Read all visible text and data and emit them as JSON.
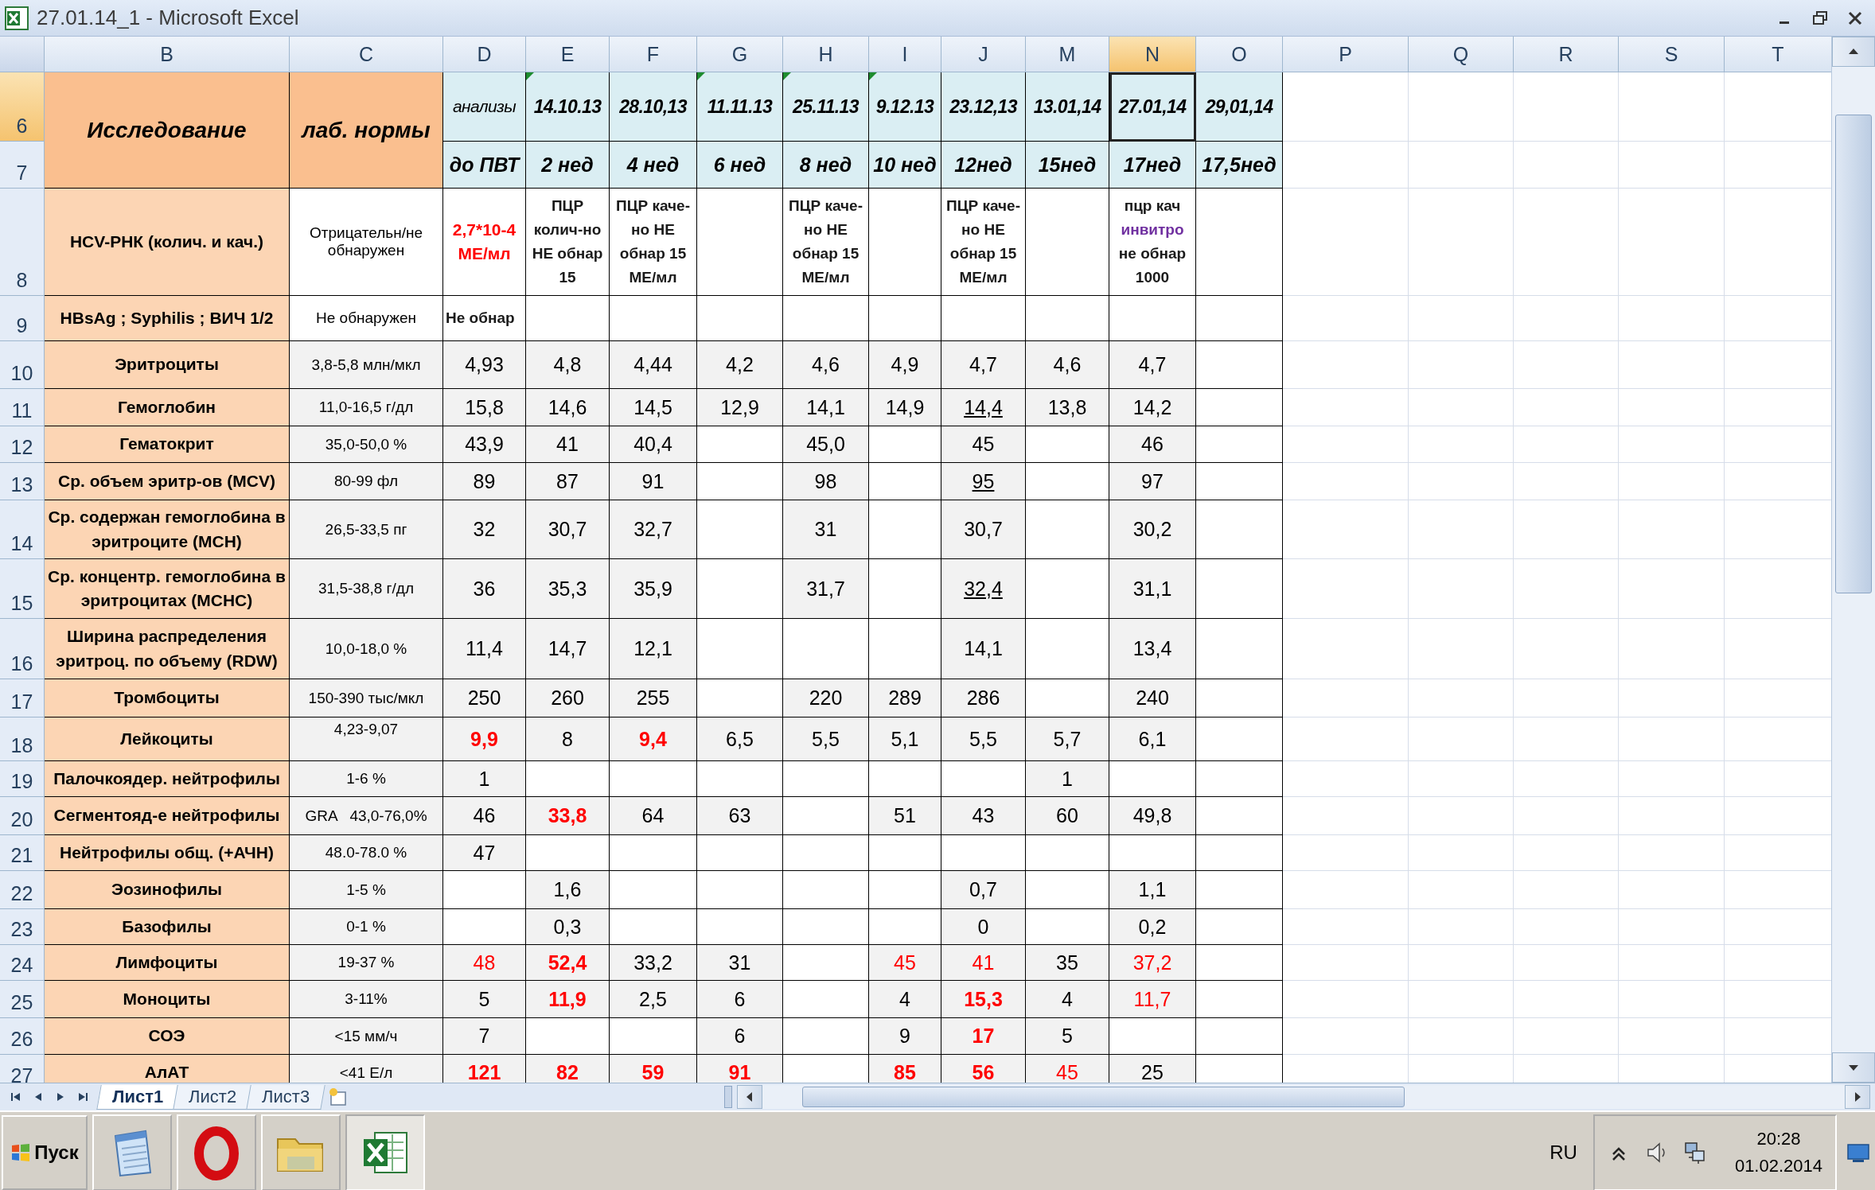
{
  "window": {
    "title": "27.01.14_1 - Microsoft Excel"
  },
  "columns": [
    {
      "label": "B",
      "selected": false
    },
    {
      "label": "C",
      "selected": false
    },
    {
      "label": "D",
      "selected": false
    },
    {
      "label": "E",
      "selected": false
    },
    {
      "label": "F",
      "selected": false
    },
    {
      "label": "G",
      "selected": false
    },
    {
      "label": "H",
      "selected": false
    },
    {
      "label": "I",
      "selected": false
    },
    {
      "label": "J",
      "selected": false
    },
    {
      "label": "M",
      "selected": false
    },
    {
      "label": "N",
      "selected": true
    },
    {
      "label": "O",
      "selected": false
    },
    {
      "label": "P",
      "selected": false
    },
    {
      "label": "Q",
      "selected": false
    },
    {
      "label": "R",
      "selected": false
    },
    {
      "label": "S",
      "selected": false
    },
    {
      "label": "T",
      "selected": false
    }
  ],
  "header": {
    "study": "Исследование",
    "norms": "лаб. нормы",
    "row_numbers": [
      {
        "label": "6",
        "selected": true
      },
      {
        "label": "7",
        "selected": false
      }
    ],
    "dates": [
      {
        "text": "анализы",
        "kind": "caption",
        "flagged": false,
        "selected": false
      },
      {
        "text": "14.10.13",
        "kind": "date",
        "flagged": true,
        "selected": false
      },
      {
        "text": "28.10,13",
        "kind": "date",
        "flagged": false,
        "selected": false
      },
      {
        "text": "11.11.13",
        "kind": "date",
        "flagged": true,
        "selected": false
      },
      {
        "text": "25.11.13",
        "kind": "date",
        "flagged": true,
        "selected": false
      },
      {
        "text": "9.12.13",
        "kind": "date",
        "flagged": true,
        "selected": false
      },
      {
        "text": "23.12,13",
        "kind": "date",
        "flagged": false,
        "selected": false
      },
      {
        "text": "13.01,14",
        "kind": "date",
        "flagged": false,
        "selected": false
      },
      {
        "text": "27.01,14",
        "kind": "date",
        "flagged": false,
        "selected": true
      },
      {
        "text": "29,01,14",
        "kind": "date",
        "flagged": false,
        "selected": false
      }
    ],
    "weeks": [
      "до ПВТ",
      "2 нед",
      "4 нед",
      "6 нед",
      "8 нед",
      "10 нед",
      "12нед",
      "15нед",
      "17нед",
      "17,5нед"
    ]
  },
  "rows": [
    {
      "number": "8",
      "selected": false,
      "kind": "text",
      "test": "HCV-РНК (колич. и кач.)",
      "norm": "Отрицательн/не обнаружен",
      "values": [
        {
          "text": "2,7*10-4 МЕ/мл",
          "kind": "alert"
        },
        "ПЦР колич-но НЕ обнар 15",
        "ПЦР каче-но НЕ обнар 15 МЕ/мл",
        {
          "kind": "empty"
        },
        "ПЦР каче-но НЕ обнар 15 МЕ/мл",
        {
          "kind": "empty"
        },
        "ПЦР каче-но НЕ обнар 15 МЕ/мл",
        {
          "kind": "empty"
        },
        {
          "kind": "mixed",
          "parts": [
            {
              "text": "пцр кач",
              "kind": "plain"
            },
            {
              "text": "инвитро",
              "kind": "highlight"
            },
            {
              "text": "не обнар 1000",
              "kind": "plain"
            }
          ]
        },
        {
          "kind": "empty"
        }
      ]
    },
    {
      "number": "9",
      "selected": false,
      "kind": "text",
      "test": "HBsAg ; Syphilis ; ВИЧ 1/2",
      "norm": "Не обнаружен",
      "values": [
        {
          "text": "Не обнар",
          "kind": "bold"
        },
        {
          "kind": "empty"
        },
        {
          "kind": "empty"
        },
        {
          "kind": "empty"
        },
        {
          "kind": "empty"
        },
        {
          "kind": "empty"
        },
        {
          "kind": "empty"
        },
        {
          "kind": "empty"
        },
        {
          "kind": "empty"
        },
        {
          "kind": "empty"
        }
      ]
    },
    {
      "number": "10",
      "selected": false,
      "kind": "numeric",
      "test": "Эритроциты",
      "norm": "3,8-5,8 млн/мкл",
      "values": [
        "4,93",
        "4,8",
        "4,44",
        "4,2",
        "4,6",
        "4,9",
        "4,7",
        "4,6",
        "4,7",
        {
          "kind": "empty"
        }
      ]
    },
    {
      "number": "11",
      "selected": false,
      "kind": "numeric",
      "test": "Гемоглобин",
      "norm": "11,0-16,5 г/дл",
      "values": [
        "15,8",
        "14,6",
        "14,5",
        "12,9",
        "14,1",
        "14,9",
        {
          "text": "14,4",
          "kind": "underline"
        },
        "13,8",
        "14,2",
        {
          "kind": "empty"
        }
      ]
    },
    {
      "number": "12",
      "selected": false,
      "kind": "numeric",
      "test": "Гематокрит",
      "norm": "35,0-50,0 %",
      "values": [
        "43,9",
        "41",
        "40,4",
        {
          "kind": "empty"
        },
        "45,0",
        {
          "kind": "empty"
        },
        "45",
        {
          "kind": "empty"
        },
        "46",
        {
          "kind": "empty"
        }
      ]
    },
    {
      "number": "13",
      "selected": false,
      "kind": "numeric",
      "test": "Ср. объем эритр-ов (MCV)",
      "norm": "80-99 фл",
      "values": [
        "89",
        "87",
        "91",
        {
          "kind": "empty"
        },
        "98",
        {
          "kind": "empty"
        },
        {
          "text": "95",
          "kind": "underline"
        },
        {
          "kind": "empty"
        },
        "97",
        {
          "kind": "empty"
        }
      ]
    },
    {
      "number": "14",
      "selected": false,
      "kind": "numeric",
      "test": "Ср. содержан гемоглобина в эритроците (MCH)",
      "norm": "26,5-33,5 пг",
      "values": [
        "32",
        "30,7",
        "32,7",
        {
          "kind": "empty"
        },
        "31",
        {
          "kind": "empty"
        },
        "30,7",
        {
          "kind": "empty"
        },
        "30,2",
        {
          "kind": "empty"
        }
      ]
    },
    {
      "number": "15",
      "selected": false,
      "kind": "numeric",
      "test": "Ср. концентр. гемоглобина в эритроцитах (MCHC)",
      "norm": "31,5-38,8 г/дл",
      "values": [
        "36",
        "35,3",
        "35,9",
        {
          "kind": "empty"
        },
        "31,7",
        {
          "kind": "empty"
        },
        {
          "text": "32,4",
          "kind": "underline"
        },
        {
          "kind": "empty"
        },
        "31,1",
        {
          "kind": "empty"
        }
      ]
    },
    {
      "number": "16",
      "selected": false,
      "kind": "numeric",
      "test": "Ширина распределения эритроц. по объему (RDW)",
      "norm": "10,0-18,0 %",
      "values": [
        "11,4",
        "14,7",
        "12,1",
        {
          "kind": "empty"
        },
        {
          "kind": "empty"
        },
        {
          "kind": "empty"
        },
        "14,1",
        {
          "kind": "empty"
        },
        "13,4",
        {
          "kind": "empty"
        }
      ]
    },
    {
      "number": "17",
      "selected": false,
      "kind": "numeric",
      "test": "Тромбоциты",
      "norm": "150-390 тыс/мкл",
      "values": [
        "250",
        "260",
        "255",
        {
          "kind": "empty"
        },
        "220",
        "289",
        "286",
        {
          "kind": "empty"
        },
        "240",
        {
          "kind": "empty"
        }
      ]
    },
    {
      "number": "18",
      "selected": false,
      "kind": "numeric",
      "test": "Лейкоциты",
      "norm": "4,23-9,07",
      "values": [
        {
          "text": "9,9",
          "kind": "alert"
        },
        "8",
        {
          "text": "9,4",
          "kind": "alert"
        },
        "6,5",
        "5,5",
        "5,1",
        "5,5",
        "5,7",
        "6,1",
        {
          "kind": "empty"
        }
      ]
    },
    {
      "number": "19",
      "selected": false,
      "kind": "numeric",
      "test": "Палочкоядер. нейтрофилы",
      "norm": "1-6 %",
      "values": [
        "1",
        {
          "kind": "empty"
        },
        {
          "kind": "empty"
        },
        {
          "kind": "empty"
        },
        {
          "kind": "empty"
        },
        {
          "kind": "empty"
        },
        {
          "kind": "empty"
        },
        "1",
        {
          "kind": "empty"
        },
        {
          "kind": "empty"
        }
      ]
    },
    {
      "number": "20",
      "selected": false,
      "kind": "numeric",
      "test": "Сегментояд-е нейтрофилы",
      "norm": "GRA   43,0-76,0%",
      "values": [
        "46",
        {
          "text": "33,8",
          "kind": "alert"
        },
        "64",
        "63",
        {
          "kind": "empty"
        },
        "51",
        "43",
        "60",
        "49,8",
        {
          "kind": "empty"
        }
      ]
    },
    {
      "number": "21",
      "selected": false,
      "kind": "numeric",
      "test": "Нейтрофилы общ. (+АЧН)",
      "norm": "48.0-78.0 %",
      "values": [
        "47",
        {
          "kind": "empty"
        },
        {
          "kind": "empty"
        },
        {
          "kind": "empty"
        },
        {
          "kind": "empty"
        },
        {
          "kind": "empty"
        },
        {
          "kind": "empty"
        },
        {
          "kind": "empty"
        },
        {
          "kind": "empty"
        },
        {
          "kind": "empty"
        }
      ]
    },
    {
      "number": "22",
      "selected": false,
      "kind": "numeric",
      "test": "Эозинофилы",
      "norm": "1-5 %",
      "values": [
        {
          "kind": "empty"
        },
        "1,6",
        {
          "kind": "empty"
        },
        {
          "kind": "empty"
        },
        {
          "kind": "empty"
        },
        {
          "kind": "empty"
        },
        "0,7",
        {
          "kind": "empty"
        },
        "1,1",
        {
          "kind": "empty"
        }
      ]
    },
    {
      "number": "23",
      "selected": false,
      "kind": "numeric",
      "test": "Базофилы",
      "norm": "0-1 %",
      "values": [
        {
          "kind": "empty"
        },
        "0,3",
        {
          "kind": "empty"
        },
        {
          "kind": "empty"
        },
        {
          "kind": "empty"
        },
        {
          "kind": "empty"
        },
        "0",
        {
          "kind": "empty"
        },
        "0,2",
        {
          "kind": "empty"
        }
      ]
    },
    {
      "number": "24",
      "selected": false,
      "kind": "numeric",
      "test": "Лимфоциты",
      "norm": "19-37 %",
      "values": [
        {
          "text": "48",
          "kind": "warn"
        },
        {
          "text": "52,4",
          "kind": "alert"
        },
        "33,2",
        "31",
        {
          "kind": "empty"
        },
        {
          "text": "45",
          "kind": "warn"
        },
        {
          "text": "41",
          "kind": "warn"
        },
        "35",
        {
          "text": "37,2",
          "kind": "warn"
        },
        {
          "kind": "empty"
        }
      ]
    },
    {
      "number": "25",
      "selected": false,
      "kind": "numeric",
      "test": "Моноциты",
      "norm": "3-11%",
      "values": [
        "5",
        {
          "text": "11,9",
          "kind": "alert"
        },
        "2,5",
        "6",
        {
          "kind": "empty"
        },
        "4",
        {
          "text": "15,3",
          "kind": "alert"
        },
        "4",
        {
          "text": "11,7",
          "kind": "warn"
        },
        {
          "kind": "empty"
        }
      ]
    },
    {
      "number": "26",
      "selected": false,
      "kind": "numeric",
      "test": "СОЭ",
      "norm": "<15 мм/ч",
      "values": [
        "7",
        {
          "kind": "empty"
        },
        {
          "kind": "empty"
        },
        "6",
        {
          "kind": "empty"
        },
        "9",
        {
          "text": "17",
          "kind": "alert"
        },
        "5",
        {
          "kind": "empty"
        },
        {
          "kind": "empty"
        }
      ]
    },
    {
      "number": "27",
      "selected": false,
      "kind": "numeric",
      "test": "АлАТ",
      "norm": "<41 Е/л",
      "values": [
        {
          "text": "121",
          "kind": "alert"
        },
        {
          "text": "82",
          "kind": "alert"
        },
        {
          "text": "59",
          "kind": "alert"
        },
        {
          "text": "91",
          "kind": "alert"
        },
        {
          "kind": "empty"
        },
        {
          "text": "85",
          "kind": "alert"
        },
        {
          "text": "56",
          "kind": "alert"
        },
        {
          "text": "45",
          "kind": "warn"
        },
        "25",
        {
          "kind": "empty"
        }
      ]
    }
  ],
  "sheet_tabs": [
    {
      "label": "Лист1",
      "selected": true
    },
    {
      "label": "Лист2",
      "selected": false
    },
    {
      "label": "Лист3",
      "selected": false
    }
  ],
  "taskbar": {
    "start": "Пуск",
    "apps": [
      {
        "kind": "notepad",
        "selected": false
      },
      {
        "kind": "ring",
        "selected": false
      },
      {
        "kind": "folder",
        "selected": false
      },
      {
        "kind": "spreadsheet",
        "selected": true
      }
    ],
    "language": "RU",
    "time": "20:28",
    "date": "01.02.2014"
  }
}
